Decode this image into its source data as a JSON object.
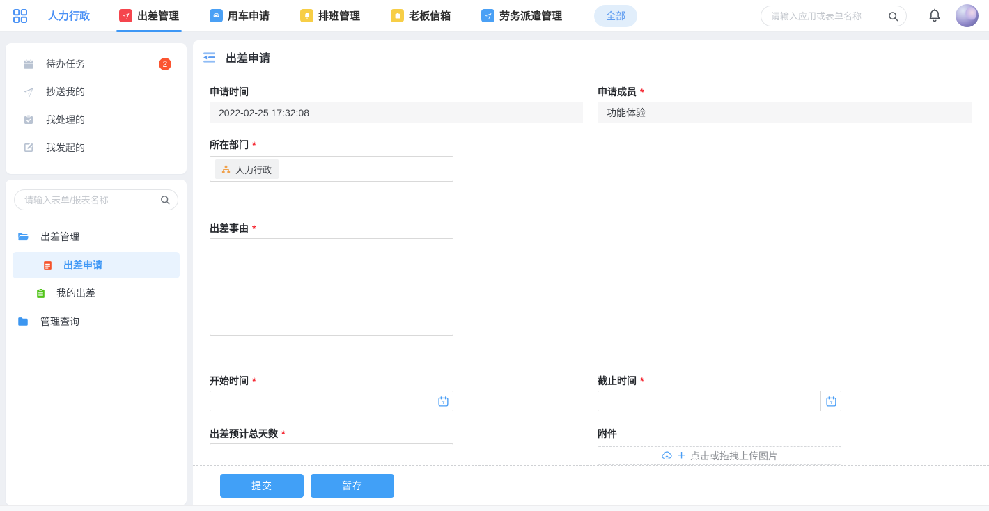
{
  "colors": {
    "accent_blue": "#3e97f5",
    "button_blue": "#41a0f7",
    "badge_red": "#fb5430",
    "tab_icon_red": "#f5454d",
    "tab_icon_blue": "#4aa0f5",
    "tab_icon_yellow": "#f7ce46",
    "selected_row_bg": "#e9f3fe",
    "folder_blue": "#4aa0f5",
    "doc_icon_orange": "#f5532b",
    "clipboard_icon_green": "#52c41a",
    "required_red": "#f5222d"
  },
  "topbar": {
    "workspace_label": "人力行政",
    "tabs": [
      {
        "label": "出差管理",
        "icon": "paper-plane-icon",
        "icon_color": "#f5454d",
        "active": true
      },
      {
        "label": "用车申请",
        "icon": "car-icon",
        "icon_color": "#4aa0f5",
        "active": false
      },
      {
        "label": "排班管理",
        "icon": "bell-icon",
        "icon_color": "#f7ce46",
        "active": false
      },
      {
        "label": "老板信箱",
        "icon": "mailbox-icon",
        "icon_color": "#f7ce46",
        "active": false
      },
      {
        "label": "劳务派遣管理",
        "icon": "paper-plane-icon",
        "icon_color": "#4aa0f5",
        "active": false
      }
    ],
    "all_pill_label": "全部",
    "search_placeholder": "请输入应用或表单名称"
  },
  "sidebar": {
    "task_items": [
      {
        "label": "待办任务",
        "icon": "calendar-icon",
        "badge": "2"
      },
      {
        "label": "抄送我的",
        "icon": "send-icon",
        "badge": ""
      },
      {
        "label": "我处理的",
        "icon": "clipboard-check-icon",
        "badge": ""
      },
      {
        "label": "我发起的",
        "icon": "compose-icon",
        "badge": ""
      }
    ],
    "search_placeholder": "请输入表单/报表名称",
    "tree": {
      "folder1": "出差管理",
      "item_selected": "出差申请",
      "item2": "我的出差",
      "folder2": "管理查询"
    }
  },
  "main": {
    "title": "出差申请",
    "required_mark": "*",
    "form": {
      "apply_time": {
        "label": "申请时间",
        "value": "2022-02-25 17:32:08"
      },
      "apply_member": {
        "label": "申请成员",
        "value": "功能体验"
      },
      "department": {
        "label": "所在部门",
        "tag": "人力行政"
      },
      "reason": {
        "label": "出差事由",
        "value": ""
      },
      "start_time": {
        "label": "开始时间",
        "value": ""
      },
      "end_time": {
        "label": "截止时间",
        "value": ""
      },
      "total_days": {
        "label": "出差预计总天数",
        "value": ""
      },
      "attachment": {
        "label": "附件",
        "upload_hint": "点击或拖拽上传图片"
      }
    },
    "footer": {
      "submit_label": "提交",
      "save_label": "暂存"
    }
  }
}
